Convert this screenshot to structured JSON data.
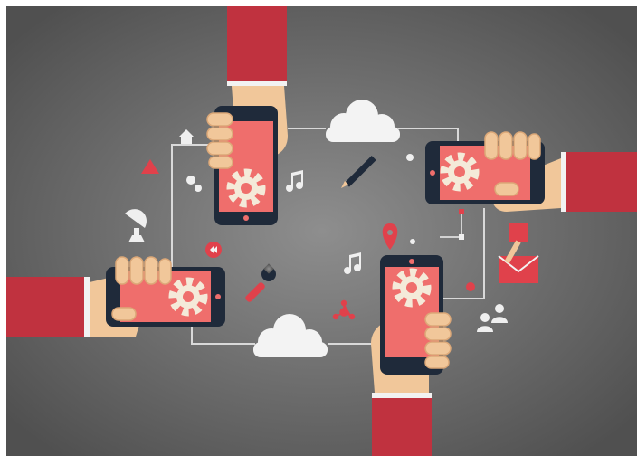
{
  "illustration": {
    "colors": {
      "background_light": "#8e8e8e",
      "background_dark": "#505050",
      "sleeve_red": "#c0323f",
      "sleeve_shadow": "#a4262f",
      "cuff_white": "#f2f2f2",
      "skin": "#f1c79a",
      "skin_shadow": "#dca878",
      "phone_body": "#1f2a3a",
      "phone_screen": "#ef6e6c",
      "gear_white": "#f4ead9",
      "cloud_white": "#f3f3f3",
      "connector_line": "#d9d9d9",
      "icon_red": "#e0414b",
      "icon_light": "#efefef"
    },
    "phones": [
      {
        "name": "top-phone",
        "orientation": "portrait"
      },
      {
        "name": "right-phone",
        "orientation": "landscape"
      },
      {
        "name": "left-phone",
        "orientation": "landscape"
      },
      {
        "name": "bottom-phone",
        "orientation": "portrait"
      }
    ],
    "icons": [
      "house-icon",
      "triangle-icon",
      "gears-icon",
      "satellite-dish-icon",
      "rewind-icon",
      "wrench-icon",
      "music-note-icon",
      "pencil-icon",
      "map-pin-icon",
      "flowchart-icon",
      "network-icon",
      "envelope-icon",
      "users-icon",
      "cloud-icon"
    ]
  }
}
